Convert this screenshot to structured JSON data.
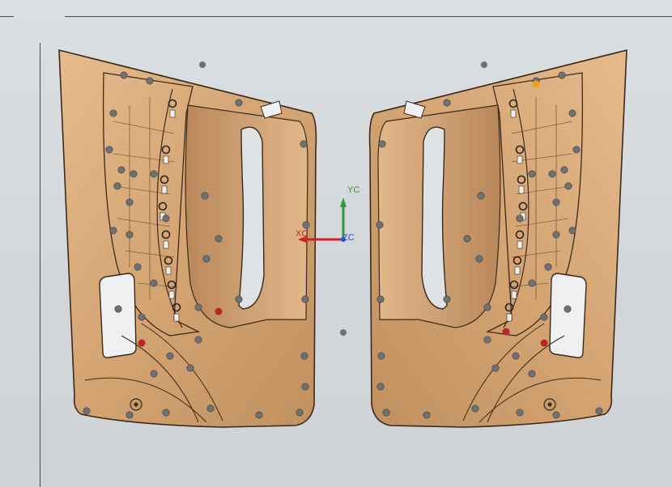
{
  "viewport": {
    "background_color": "#d6dadd"
  },
  "triad": {
    "x_label": "XC",
    "y_label": "YC",
    "z_label": "ZC",
    "x_color": "#d0202a",
    "y_color": "#2f9a3a",
    "z_color": "#2a4fd6"
  },
  "model": {
    "name_icon": "door-trim-panel-icon",
    "surface_color": "#d9a877",
    "edge_color": "#3b2a1c"
  }
}
